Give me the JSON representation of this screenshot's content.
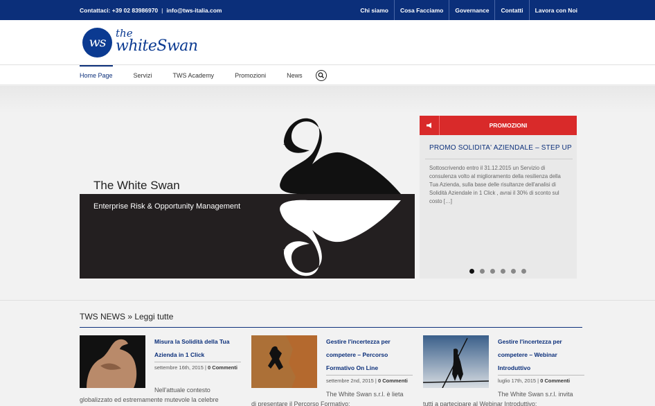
{
  "topbar": {
    "contact_phone": "Contattaci: +39 02 83986970",
    "separator": "|",
    "contact_email": "info@tws-italia.com",
    "menu": [
      "Chi siamo",
      "Cosa Facciamo",
      "Governance",
      "Contatti",
      "Lavora con Noi"
    ]
  },
  "logo": {
    "monogram": "ws",
    "the": "the",
    "name": "whiteSwan"
  },
  "nav": {
    "items": [
      "Home Page",
      "Servizi",
      "TWS Academy",
      "Promozioni",
      "News"
    ],
    "active": "Home Page",
    "search_icon": "search-icon"
  },
  "slider": {
    "title": "The White Swan",
    "subtitle": "Enterprise Risk & Opportunity Management"
  },
  "promo": {
    "icon": "megaphone-icon",
    "header": "PROMOZIONI",
    "title": "PROMO SOLIDITA' AZIENDALE – STEP UP",
    "text": "Sottoscrivendo entro il 31.12.2015 un Servizio di consulenza volto al miglioramento della resilienza della Tua Azienda, sulla base delle risultanze dell'analisi di Solidità Aziendale in 1 Click , avrai il 30% di sconto sul costo […]",
    "dots": 6,
    "active_dot": 1
  },
  "news": {
    "heading": "TWS NEWS » Leggi tutte",
    "posts": [
      {
        "title": "Misura la Solidità della Tua Azienda in 1 Click",
        "date": "settembre 16th, 2015",
        "sep": "|",
        "comments": "0 Commenti",
        "excerpt_1": "Nell'attuale contesto",
        "excerpt_2": "globalizzato ed estremamente mutevole la celebre"
      },
      {
        "title": "Gestire l'incertezza per competere – Percorso Formativo On Line",
        "date": "settembre 2nd, 2015",
        "sep": "|",
        "comments": "0 Commenti",
        "excerpt_1": "The White Swan s.r.l. è lieta",
        "excerpt_2": "di presentare il Percorso Formativo:"
      },
      {
        "title": "Gestire l'incertezza per competere – Webinar Introduttivo",
        "date": "luglio 17th, 2015",
        "sep": "|",
        "comments": "0 Commenti",
        "excerpt_1": "The White Swan s.r.l. invita",
        "excerpt_2": "tutti a partecipare al Webinar Introduttivo:"
      }
    ]
  },
  "colors": {
    "brand_blue": "#0b2f7a",
    "promo_red": "#d92a2a"
  }
}
